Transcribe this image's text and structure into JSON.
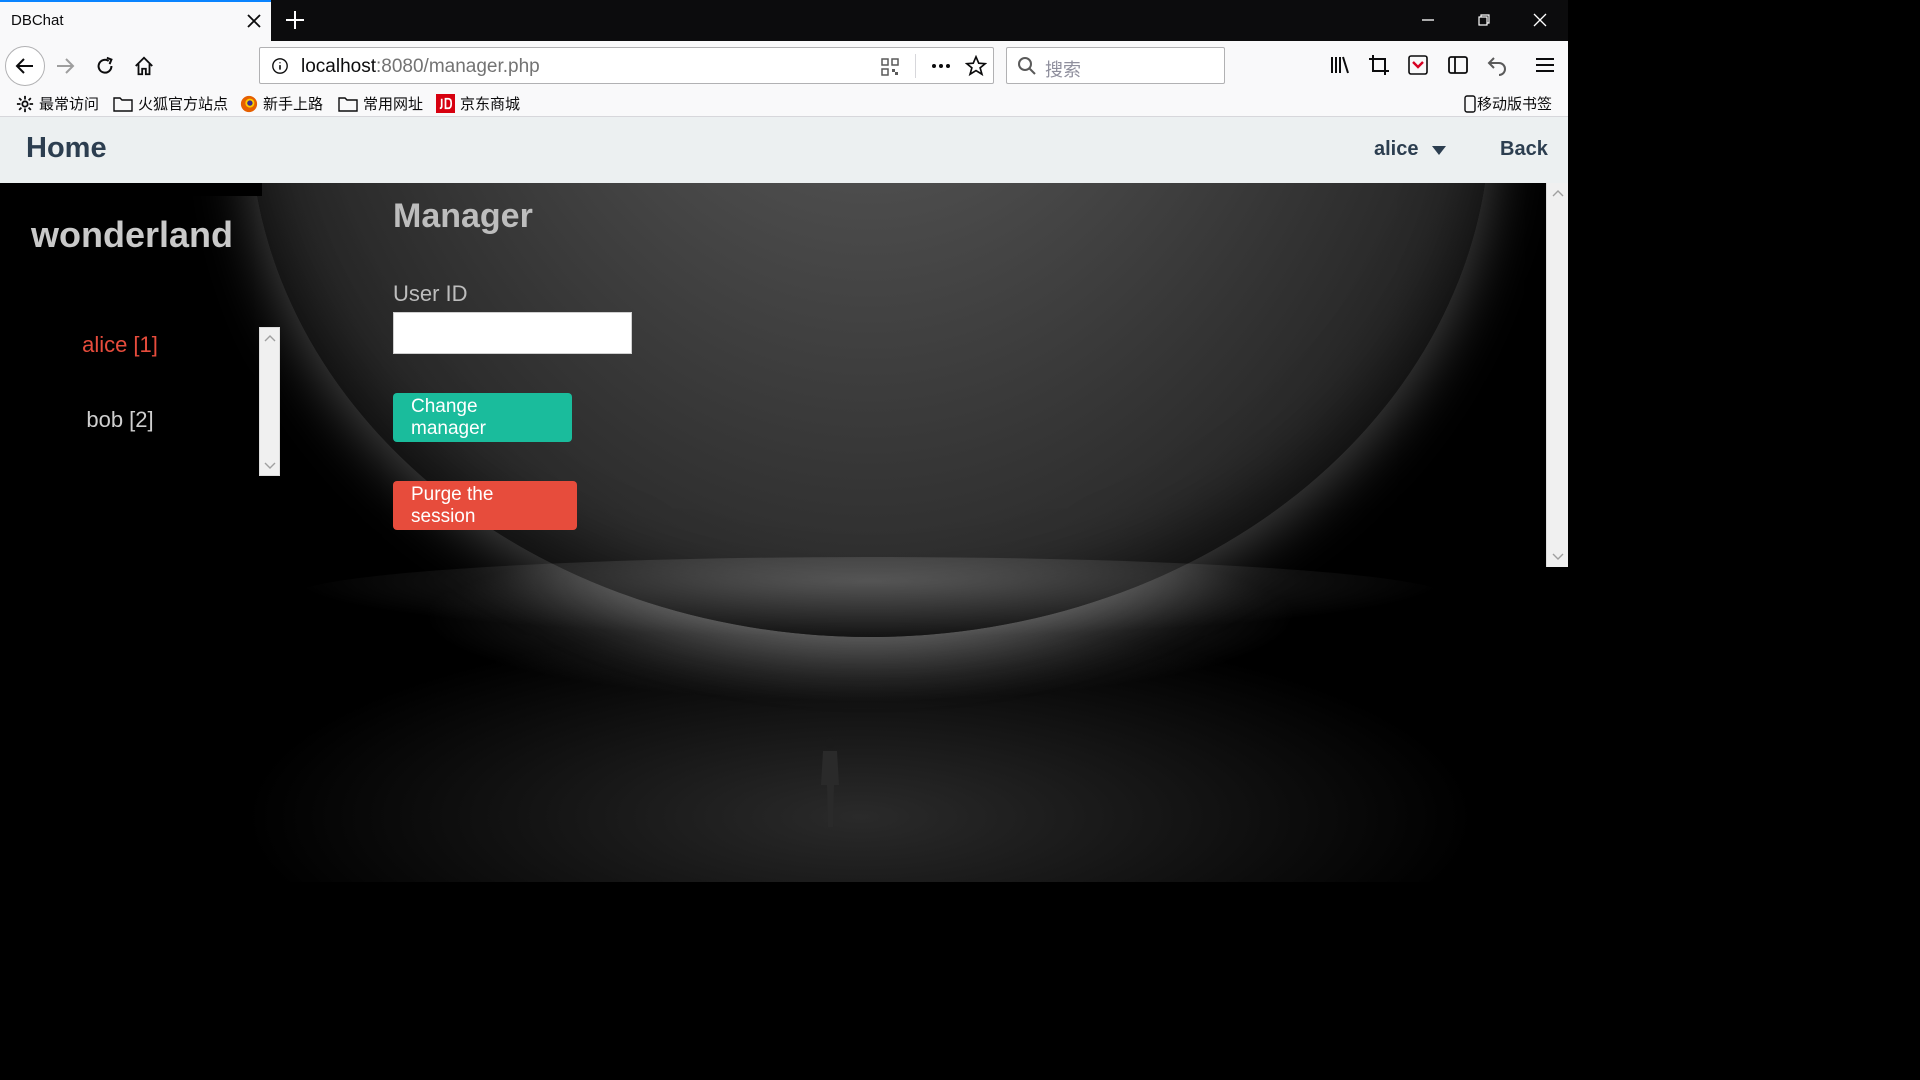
{
  "browser": {
    "tab_title": "DBChat",
    "url_host": "localhost",
    "url_rest": ":8080/manager.php",
    "search_placeholder": "搜索",
    "bookmarks": [
      {
        "label": "最常访问",
        "icon": "gear-icon"
      },
      {
        "label": "火狐官方站点",
        "icon": "folder-icon"
      },
      {
        "label": "新手上路",
        "icon": "firefox-icon"
      },
      {
        "label": "常用网址",
        "icon": "folder-icon"
      },
      {
        "label": "京东商城",
        "icon": "jd-icon"
      }
    ],
    "mobile_bookmarks": "移动版书签"
  },
  "header": {
    "home": "Home",
    "user": "alice",
    "back": "Back"
  },
  "sidebar": {
    "room_name": "wonderland",
    "users": [
      {
        "label": "alice [1]",
        "active": true
      },
      {
        "label": "bob [2]",
        "active": false
      }
    ]
  },
  "main": {
    "title": "Manager",
    "user_id_label": "User ID",
    "user_id_value": "",
    "change_button": "Change manager",
    "purge_button": "Purge the session"
  },
  "colors": {
    "header_bg": "#ecf0f1",
    "header_text": "#2c3e50",
    "active_user": "#e74c3c",
    "change_btn": "#1abc9c",
    "purge_btn": "#e74c3c"
  }
}
